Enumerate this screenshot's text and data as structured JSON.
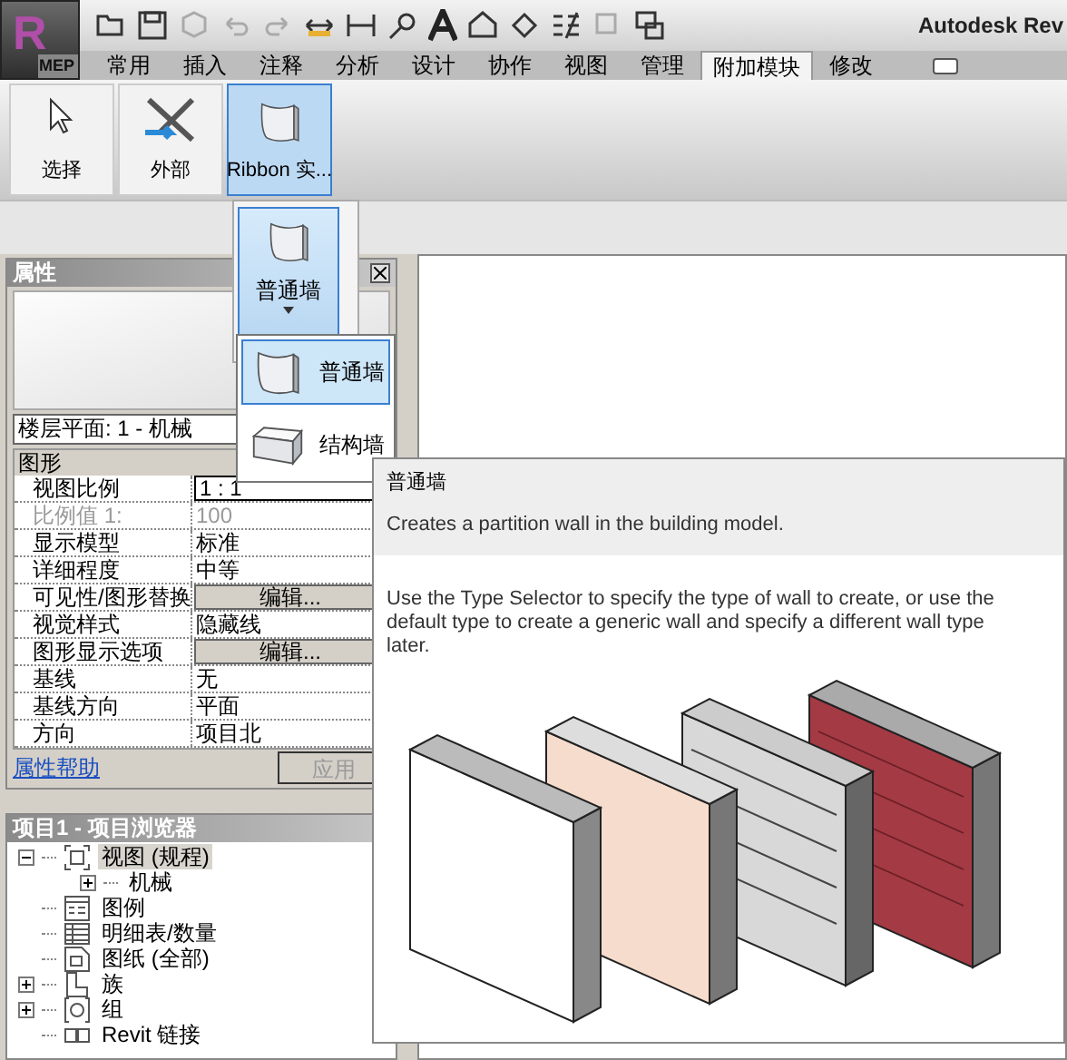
{
  "app_menu": {
    "logo": "R",
    "label": "MEP"
  },
  "window": {
    "title": "Autodesk Rev"
  },
  "ribbon_tabs": [
    {
      "label": "常用",
      "selected": false
    },
    {
      "label": "插入",
      "selected": false
    },
    {
      "label": "注释",
      "selected": false
    },
    {
      "label": "分析",
      "selected": false
    },
    {
      "label": "设计",
      "selected": false
    },
    {
      "label": "协作",
      "selected": false
    },
    {
      "label": "视图",
      "selected": false
    },
    {
      "label": "管理",
      "selected": false
    },
    {
      "label": "附加模块",
      "selected": true
    },
    {
      "label": "修改",
      "selected": false
    }
  ],
  "ribbon_buttons": [
    {
      "label": "选择",
      "kind": "select",
      "selected": false
    },
    {
      "label": "外部",
      "kind": "tools",
      "selected": false
    },
    {
      "label": "Ribbon 实...",
      "kind": "wall",
      "selected": true
    }
  ],
  "split_button": {
    "label": "普通墙"
  },
  "flyout_items": [
    {
      "label": "普通墙",
      "kind": "curved",
      "selected": true
    },
    {
      "label": "结构墙",
      "kind": "box",
      "selected": false
    }
  ],
  "properties": {
    "title": "属性",
    "type_selector": "楼层平面: 1 - 机械",
    "section": "图形",
    "rows": [
      {
        "name": "视图比例",
        "value": "1 : 1",
        "kind": "input",
        "disabled": false
      },
      {
        "name": "比例值 1:",
        "value": "100",
        "kind": "text",
        "disabled": true
      },
      {
        "name": "显示模型",
        "value": "标准",
        "kind": "text",
        "disabled": false
      },
      {
        "name": "详细程度",
        "value": "中等",
        "kind": "text",
        "disabled": false
      },
      {
        "name": "可见性/图形替换",
        "value": "编辑...",
        "kind": "button",
        "disabled": false
      },
      {
        "name": "视觉样式",
        "value": "隐藏线",
        "kind": "text",
        "disabled": false
      },
      {
        "name": "图形显示选项",
        "value": "编辑...",
        "kind": "button",
        "disabled": false
      },
      {
        "name": "基线",
        "value": "无",
        "kind": "text",
        "disabled": false
      },
      {
        "name": "基线方向",
        "value": "平面",
        "kind": "text",
        "disabled": false
      },
      {
        "name": "方向",
        "value": "项目北",
        "kind": "text",
        "disabled": false
      }
    ],
    "help_link": "属性帮助",
    "apply_button": {
      "label": "应用",
      "disabled": true
    }
  },
  "project_browser": {
    "title": "项目1 - 项目浏览器",
    "tree": [
      {
        "label": "视图 (规程)",
        "kind": "view",
        "expanded": true,
        "selected": true,
        "children": [
          {
            "label": "机械",
            "expanded": false,
            "selected": false
          }
        ]
      },
      {
        "label": "图例",
        "kind": "legend",
        "selected": false
      },
      {
        "label": "明细表/数量",
        "kind": "schedule",
        "selected": false
      },
      {
        "label": "图纸 (全部)",
        "kind": "sheet",
        "selected": false
      },
      {
        "label": "族",
        "kind": "family",
        "expanded": false,
        "selected": false
      },
      {
        "label": "组",
        "kind": "group",
        "expanded": false,
        "selected": false
      },
      {
        "label": "Revit 链接",
        "kind": "link",
        "selected": false
      }
    ]
  },
  "tooltip": {
    "title": "普通墙",
    "summary": "Creates a partition wall in the building model.",
    "description": "Use the Type Selector to specify the type of wall to create, or use the default type to create a generic wall and specify a different wall type later."
  }
}
